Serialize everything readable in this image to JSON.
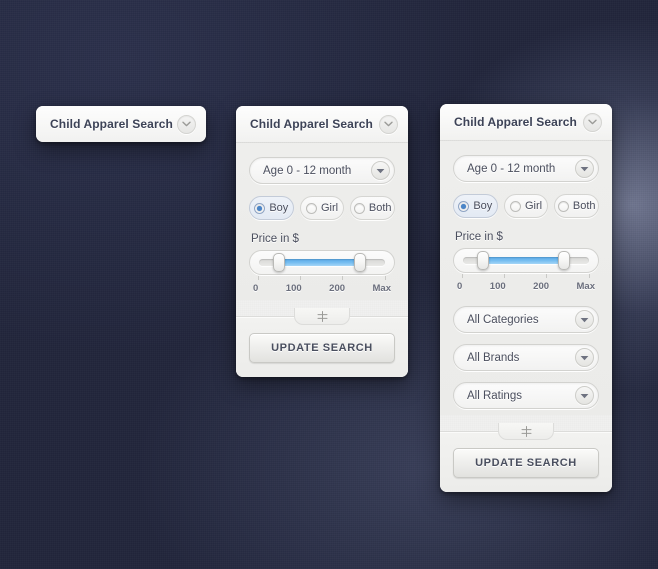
{
  "panels": {
    "collapsed": {
      "title": "Child Apparel Search",
      "collapse_icon": "chevron-down-icon"
    },
    "medium": {
      "title": "Child Apparel Search",
      "collapse_icon": "chevron-down-icon",
      "age_select": {
        "value": "Age 0 - 12 month",
        "arrow_icon": "caret-down-icon"
      },
      "gender": {
        "options": [
          {
            "label": "Boy",
            "selected": true
          },
          {
            "label": "Girl",
            "selected": false
          },
          {
            "label": "Both",
            "selected": false
          }
        ]
      },
      "price": {
        "label": "Price in $",
        "scale": [
          "0",
          "100",
          "200",
          "Max"
        ],
        "min_percent": 16,
        "max_percent": 80
      },
      "grip_icon": "resize-grip-icon",
      "update_label": "UPDATE SEARCH"
    },
    "full": {
      "title": "Child Apparel Search",
      "collapse_icon": "chevron-down-icon",
      "age_select": {
        "value": "Age 0 - 12 month",
        "arrow_icon": "caret-down-icon"
      },
      "gender": {
        "options": [
          {
            "label": "Boy",
            "selected": true
          },
          {
            "label": "Girl",
            "selected": false
          },
          {
            "label": "Both",
            "selected": false
          }
        ]
      },
      "price": {
        "label": "Price in $",
        "scale": [
          "0",
          "100",
          "200",
          "Max"
        ],
        "min_percent": 16,
        "max_percent": 80
      },
      "filters": [
        {
          "value": "All Categories",
          "arrow_icon": "caret-down-icon"
        },
        {
          "value": "All Brands",
          "arrow_icon": "caret-down-icon"
        },
        {
          "value": "All Ratings",
          "arrow_icon": "caret-down-icon"
        }
      ],
      "grip_icon": "resize-grip-icon",
      "update_label": "UPDATE SEARCH"
    }
  },
  "colors": {
    "accent": "#5aaae8",
    "backdrop": "#272b42",
    "panel": "#f0f0ef",
    "title_text": "#3d4357"
  }
}
